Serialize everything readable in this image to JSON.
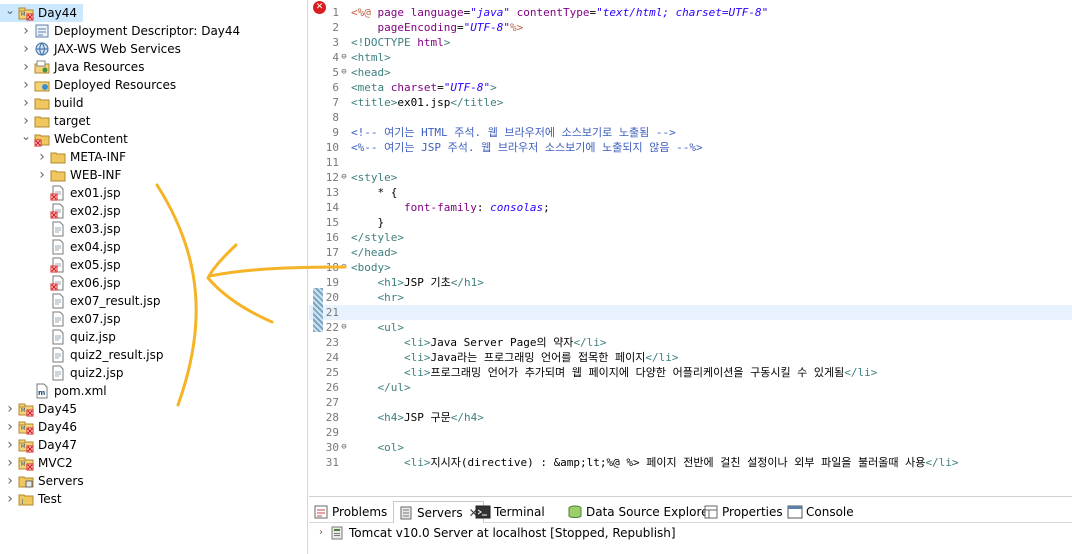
{
  "explorer": {
    "items": [
      {
        "label": "Day44",
        "icon": "project-icon",
        "twisty": "open",
        "indent": 0,
        "selected": true
      },
      {
        "label": "Deployment Descriptor: Day44",
        "icon": "deployment-descriptor-icon",
        "twisty": "closed",
        "indent": 1
      },
      {
        "label": "JAX-WS Web Services",
        "icon": "webservices-icon",
        "twisty": "closed",
        "indent": 1
      },
      {
        "label": "Java Resources",
        "icon": "java-resources-icon",
        "twisty": "closed",
        "indent": 1
      },
      {
        "label": "Deployed Resources",
        "icon": "deployed-resources-icon",
        "twisty": "closed",
        "indent": 1
      },
      {
        "label": "build",
        "icon": "folder-icon",
        "twisty": "closed",
        "indent": 1
      },
      {
        "label": "target",
        "icon": "folder-icon",
        "twisty": "closed",
        "indent": 1
      },
      {
        "label": "WebContent",
        "icon": "folder-error-icon",
        "twisty": "open",
        "indent": 1
      },
      {
        "label": "META-INF",
        "icon": "folder-icon",
        "twisty": "closed",
        "indent": 2
      },
      {
        "label": "WEB-INF",
        "icon": "folder-icon",
        "twisty": "closed",
        "indent": 2
      },
      {
        "label": "ex01.jsp",
        "icon": "jsp-file-error-icon",
        "twisty": "none",
        "indent": 2
      },
      {
        "label": "ex02.jsp",
        "icon": "jsp-file-error-icon",
        "twisty": "none",
        "indent": 2
      },
      {
        "label": "ex03.jsp",
        "icon": "jsp-file-icon",
        "twisty": "none",
        "indent": 2
      },
      {
        "label": "ex04.jsp",
        "icon": "jsp-file-icon",
        "twisty": "none",
        "indent": 2
      },
      {
        "label": "ex05.jsp",
        "icon": "jsp-file-error-icon",
        "twisty": "none",
        "indent": 2
      },
      {
        "label": "ex06.jsp",
        "icon": "jsp-file-error-icon",
        "twisty": "none",
        "indent": 2
      },
      {
        "label": "ex07_result.jsp",
        "icon": "jsp-file-icon",
        "twisty": "none",
        "indent": 2
      },
      {
        "label": "ex07.jsp",
        "icon": "jsp-file-icon",
        "twisty": "none",
        "indent": 2
      },
      {
        "label": "quiz.jsp",
        "icon": "jsp-file-icon",
        "twisty": "none",
        "indent": 2
      },
      {
        "label": "quiz2_result.jsp",
        "icon": "jsp-file-icon",
        "twisty": "none",
        "indent": 2
      },
      {
        "label": "quiz2.jsp",
        "icon": "jsp-file-icon",
        "twisty": "none",
        "indent": 2
      },
      {
        "label": "pom.xml",
        "icon": "maven-pom-icon",
        "twisty": "none",
        "indent": 1
      },
      {
        "label": "Day45",
        "icon": "project-icon",
        "twisty": "closed",
        "indent": 0
      },
      {
        "label": "Day46",
        "icon": "project-icon",
        "twisty": "closed",
        "indent": 0
      },
      {
        "label": "Day47",
        "icon": "project-icon",
        "twisty": "closed",
        "indent": 0
      },
      {
        "label": "MVC2",
        "icon": "project-icon",
        "twisty": "closed",
        "indent": 0
      },
      {
        "label": "Servers",
        "icon": "servers-folder-icon",
        "twisty": "closed",
        "indent": 0
      },
      {
        "label": "Test",
        "icon": "test-project-icon",
        "twisty": "closed",
        "indent": 0
      }
    ]
  },
  "editor": {
    "lines": [
      {
        "n": "1",
        "fold": "",
        "parts": [
          [
            "jsp",
            "<%@ "
          ],
          [
            "attr",
            "page "
          ],
          [
            "attr",
            "language"
          ],
          [
            "text",
            "="
          ],
          [
            "val",
            "\"java\""
          ],
          [
            "text",
            " "
          ],
          [
            "attr",
            "contentType"
          ],
          [
            "text",
            "="
          ],
          [
            "val",
            "\"text/html; charset=UTF-8\""
          ]
        ]
      },
      {
        "n": "2",
        "fold": "",
        "parts": [
          [
            "text",
            "    "
          ],
          [
            "attr",
            "pageEncoding"
          ],
          [
            "text",
            "="
          ],
          [
            "val",
            "\"UTF-8\""
          ],
          [
            "jsp",
            "%>"
          ]
        ]
      },
      {
        "n": "3",
        "fold": "",
        "parts": [
          [
            "tag",
            "<!DOCTYPE "
          ],
          [
            "attr",
            "html"
          ],
          [
            "tag",
            ">"
          ]
        ]
      },
      {
        "n": "4",
        "fold": "⊖",
        "parts": [
          [
            "tag",
            "<html>"
          ]
        ]
      },
      {
        "n": "5",
        "fold": "⊖",
        "parts": [
          [
            "tag",
            "<head>"
          ]
        ]
      },
      {
        "n": "6",
        "fold": "",
        "parts": [
          [
            "tag",
            "<meta "
          ],
          [
            "attr",
            "charset"
          ],
          [
            "text",
            "="
          ],
          [
            "val",
            "\"UTF-8\""
          ],
          [
            "tag",
            ">"
          ]
        ]
      },
      {
        "n": "7",
        "fold": "",
        "parts": [
          [
            "tag",
            "<title>"
          ],
          [
            "text",
            "ex01.jsp"
          ],
          [
            "tag",
            "</title>"
          ]
        ]
      },
      {
        "n": "8",
        "fold": "",
        "parts": []
      },
      {
        "n": "9",
        "fold": "",
        "parts": [
          [
            "com",
            "<!-- 여기는 HTML 주석. 웹 브라우저에 소스보기로 노출됨 -->"
          ]
        ]
      },
      {
        "n": "10",
        "fold": "",
        "parts": [
          [
            "com",
            "<%-- 여기는 JSP 주석. 웹 브라우저 소스보기에 노출되지 않음 --%>"
          ]
        ]
      },
      {
        "n": "11",
        "fold": "",
        "parts": []
      },
      {
        "n": "12",
        "fold": "⊖",
        "parts": [
          [
            "tag",
            "<style>"
          ]
        ]
      },
      {
        "n": "13",
        "fold": "",
        "parts": [
          [
            "text",
            "    * {"
          ]
        ]
      },
      {
        "n": "14",
        "fold": "",
        "parts": [
          [
            "text",
            "        "
          ],
          [
            "attr",
            "font-family"
          ],
          [
            "text",
            ": "
          ],
          [
            "val",
            "consolas"
          ],
          [
            "text",
            ";"
          ]
        ]
      },
      {
        "n": "15",
        "fold": "",
        "parts": [
          [
            "text",
            "    }"
          ]
        ]
      },
      {
        "n": "16",
        "fold": "",
        "parts": [
          [
            "tag",
            "</style>"
          ]
        ]
      },
      {
        "n": "17",
        "fold": "",
        "parts": [
          [
            "tag",
            "</head>"
          ]
        ]
      },
      {
        "n": "18",
        "fold": "⊖",
        "parts": [
          [
            "tag",
            "<body>"
          ]
        ]
      },
      {
        "n": "19",
        "fold": "",
        "parts": [
          [
            "text",
            "    "
          ],
          [
            "tag",
            "<h1>"
          ],
          [
            "text",
            "JSP 기초"
          ],
          [
            "tag",
            "</h1>"
          ]
        ]
      },
      {
        "n": "20",
        "fold": "",
        "parts": [
          [
            "text",
            "    "
          ],
          [
            "tag",
            "<hr>"
          ]
        ]
      },
      {
        "n": "21",
        "fold": "",
        "parts": [],
        "current": true
      },
      {
        "n": "22",
        "fold": "⊖",
        "parts": [
          [
            "text",
            "    "
          ],
          [
            "tag",
            "<ul>"
          ]
        ]
      },
      {
        "n": "23",
        "fold": "",
        "parts": [
          [
            "text",
            "        "
          ],
          [
            "tag",
            "<li>"
          ],
          [
            "text",
            "Java Server Page의 약자"
          ],
          [
            "tag",
            "</li>"
          ]
        ]
      },
      {
        "n": "24",
        "fold": "",
        "parts": [
          [
            "text",
            "        "
          ],
          [
            "tag",
            "<li>"
          ],
          [
            "text",
            "Java라는 프로그래밍 언어를 접목한 페이지"
          ],
          [
            "tag",
            "</li>"
          ]
        ]
      },
      {
        "n": "25",
        "fold": "",
        "parts": [
          [
            "text",
            "        "
          ],
          [
            "tag",
            "<li>"
          ],
          [
            "text",
            "프로그래밍 언어가 추가되며 웹 페이지에 다양한 어플리케이션을 구동시킬 수 있게됨"
          ],
          [
            "tag",
            "</li>"
          ]
        ]
      },
      {
        "n": "26",
        "fold": "",
        "parts": [
          [
            "text",
            "    "
          ],
          [
            "tag",
            "</ul>"
          ]
        ]
      },
      {
        "n": "27",
        "fold": "",
        "parts": []
      },
      {
        "n": "28",
        "fold": "",
        "parts": [
          [
            "text",
            "    "
          ],
          [
            "tag",
            "<h4>"
          ],
          [
            "text",
            "JSP 구문"
          ],
          [
            "tag",
            "</h4>"
          ]
        ]
      },
      {
        "n": "29",
        "fold": "",
        "parts": []
      },
      {
        "n": "30",
        "fold": "⊖",
        "parts": [
          [
            "text",
            "    "
          ],
          [
            "tag",
            "<ol>"
          ]
        ]
      },
      {
        "n": "31",
        "fold": "",
        "parts": [
          [
            "text",
            "        "
          ],
          [
            "tag",
            "<li>"
          ],
          [
            "text",
            "지시자(directive) : "
          ],
          [
            "ent",
            "&amp;lt;%@ %>"
          ],
          [
            "text",
            " 페이지 전반에 걸친 설정이나 외부 파일을 불러올때 사용"
          ],
          [
            "tag",
            "</li>"
          ]
        ]
      }
    ]
  },
  "bottom_panel": {
    "tabs": [
      {
        "label": "Problems",
        "icon": "problems-icon",
        "active": false
      },
      {
        "label": "Servers",
        "icon": "servers-icon",
        "active": true
      },
      {
        "label": "Terminal",
        "icon": "terminal-icon",
        "active": false
      },
      {
        "label": "Data Source Explorer",
        "icon": "data-source-icon",
        "active": false
      },
      {
        "label": "Properties",
        "icon": "properties-icon",
        "active": false
      },
      {
        "label": "Console",
        "icon": "console-icon",
        "active": false
      }
    ],
    "server_entry": "Tomcat v10.0 Server at localhost  [Stopped, Republish]"
  },
  "colors": {
    "selection": "#cce8ff",
    "annotation_arrow": "#f5b325",
    "error": "#d81e1e",
    "folder": "#e8b64c"
  }
}
